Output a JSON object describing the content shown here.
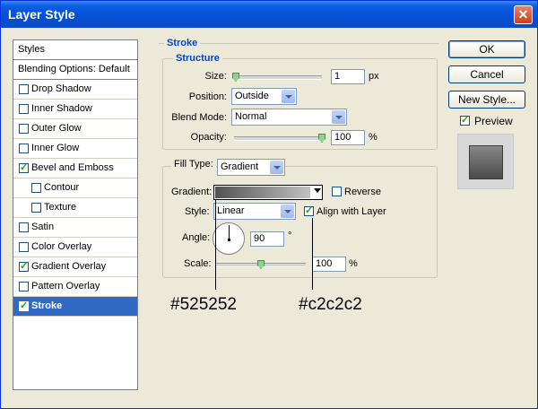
{
  "window": {
    "title": "Layer Style"
  },
  "styles_list": {
    "header": "Styles",
    "blending": "Blending Options: Default",
    "items": [
      {
        "label": "Drop Shadow",
        "checked": false,
        "indent": false
      },
      {
        "label": "Inner Shadow",
        "checked": false,
        "indent": false
      },
      {
        "label": "Outer Glow",
        "checked": false,
        "indent": false
      },
      {
        "label": "Inner Glow",
        "checked": false,
        "indent": false
      },
      {
        "label": "Bevel and Emboss",
        "checked": true,
        "indent": false
      },
      {
        "label": "Contour",
        "checked": false,
        "indent": true
      },
      {
        "label": "Texture",
        "checked": false,
        "indent": true
      },
      {
        "label": "Satin",
        "checked": false,
        "indent": false
      },
      {
        "label": "Color Overlay",
        "checked": false,
        "indent": false
      },
      {
        "label": "Gradient Overlay",
        "checked": true,
        "indent": false
      },
      {
        "label": "Pattern Overlay",
        "checked": false,
        "indent": false
      },
      {
        "label": "Stroke",
        "checked": true,
        "indent": false,
        "selected": true
      }
    ]
  },
  "stroke": {
    "section": "Stroke",
    "structure": {
      "label": "Structure",
      "size_label": "Size:",
      "size_value": "1",
      "size_unit": "px",
      "position_label": "Position:",
      "position_value": "Outside",
      "blend_label": "Blend Mode:",
      "blend_value": "Normal",
      "opacity_label": "Opacity:",
      "opacity_value": "100",
      "opacity_unit": "%"
    },
    "fill": {
      "type_label": "Fill Type:",
      "type_value": "Gradient",
      "gradient_label": "Gradient:",
      "reverse_label": "Reverse",
      "reverse_checked": false,
      "style_label": "Style:",
      "style_value": "Linear",
      "align_label": "Align with Layer",
      "align_checked": true,
      "angle_label": "Angle:",
      "angle_value": "90",
      "angle_unit": "°",
      "scale_label": "Scale:",
      "scale_value": "100",
      "scale_unit": "%"
    }
  },
  "buttons": {
    "ok": "OK",
    "cancel": "Cancel",
    "new_style": "New Style...",
    "preview_label": "Preview",
    "preview_checked": true
  },
  "annotations": {
    "left_color": "#525252",
    "right_color": "#c2c2c2"
  },
  "colors": {
    "gradient_start": "#525252",
    "gradient_end": "#c2c2c2",
    "selection": "#316ac5",
    "title_bar": "#0551d6"
  },
  "sliders": {
    "size_fraction": 0.02,
    "opacity_fraction": 1.0,
    "scale_fraction": 0.5
  }
}
